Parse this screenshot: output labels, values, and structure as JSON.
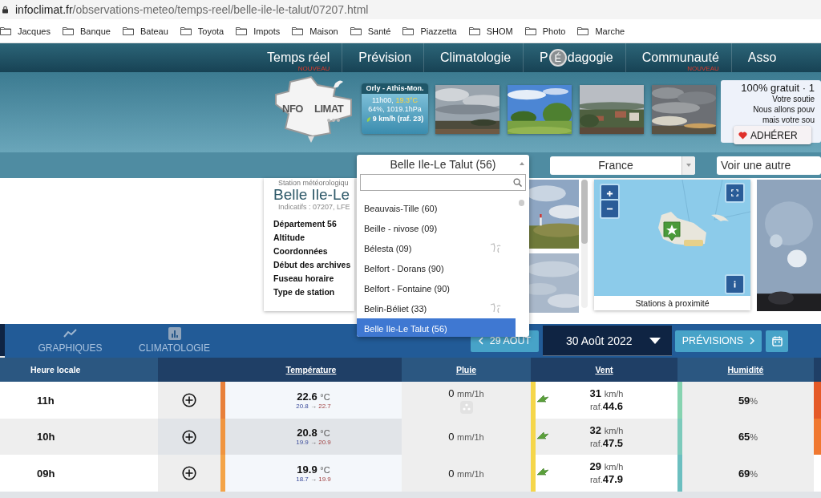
{
  "browser": {
    "url_host": "infoclimat.fr",
    "url_path": "/observations-meteo/temps-reel/belle-ile-le-talut/07207.html",
    "bookmarks": [
      "Jacques",
      "Banque",
      "Bateau",
      "Toyota",
      "Impots",
      "Maison",
      "Santé",
      "Piazzetta",
      "SHOM",
      "Photo",
      "Marche"
    ]
  },
  "nav": [
    {
      "label": "Temps réel",
      "tag": "NOUVEAU"
    },
    {
      "label": "Prévision"
    },
    {
      "label": "Climatologie"
    },
    {
      "label": "P",
      "emblem": "É",
      "label_end": "dagogie"
    },
    {
      "label": "Communauté",
      "tag": "NOUVEAU"
    },
    {
      "label": "Asso"
    }
  ],
  "logo": {
    "left": "NFO",
    "right": "LIMAT"
  },
  "live_station": {
    "name": "Orly - Athis-Mon.",
    "time": "11h00,",
    "temperature": "19.3°C",
    "humidity_pressure": "64%, 1019.1hPa",
    "wind": "9 km/h (raf. 23)"
  },
  "donation": {
    "title": "100% gratuit · 1",
    "lines": [
      "Votre soutie",
      "Nous allons pouv",
      "mais votre sou"
    ],
    "button": "ADHÉRER"
  },
  "station_select": {
    "value": "Belle Ile-Le Talut (56)",
    "expanded": true,
    "options": [
      {
        "label": "Beauvais-Tille (60)",
        "map_icon": false,
        "selected": false
      },
      {
        "label": "Beille - nivose (09)",
        "map_icon": false,
        "selected": false
      },
      {
        "label": "Bélesta (09)",
        "map_icon": true,
        "selected": false
      },
      {
        "label": "Belfort - Dorans (90)",
        "map_icon": false,
        "selected": false
      },
      {
        "label": "Belfort - Fontaine (90)",
        "map_icon": false,
        "selected": false
      },
      {
        "label": "Belin-Béliet (33)",
        "map_icon": true,
        "selected": false
      },
      {
        "label": "Belle Ile-Le Talut (56)",
        "map_icon": false,
        "selected": true
      }
    ]
  },
  "country_select": {
    "value": "France"
  },
  "station_search": {
    "placeholder": "Voir une autre"
  },
  "station": {
    "heading": "Station météorologiqu",
    "name": "Belle Ile-Le",
    "codes": "Indicatifs : 07207, LFE",
    "fields": [
      "Département 56",
      "Altitude",
      "Coordonnées",
      "Début des archives",
      "Fuseau horaire",
      "Type de station"
    ]
  },
  "map": {
    "caption": "Stations à proximité"
  },
  "tabs": [
    {
      "selected": true
    },
    {
      "label": "GRAPHIQUES",
      "selected": false
    },
    {
      "label": "CLIMATOLOGIE",
      "selected": false
    }
  ],
  "date_nav": {
    "previous": "29 AOUT",
    "date": "30 Août 2022",
    "next": "PRÉVISIONS"
  },
  "table": {
    "columns": [
      {
        "kind": "text",
        "label": "Heure locale"
      },
      {
        "kind": "blank"
      },
      {
        "kind": "link",
        "label": "Température"
      },
      {
        "kind": "link",
        "label": "Pluie"
      },
      {
        "kind": "link",
        "label": "Vent"
      },
      {
        "kind": "link",
        "label": "Humidité"
      }
    ],
    "rows": [
      {
        "hour": "11h",
        "temperature": {
          "value": "22.6",
          "unit": "°C",
          "min": "20.8",
          "arrow": "→",
          "max": "22.7",
          "color": "#e8803a"
        },
        "rain": {
          "value": "0",
          "unit": "mm/1h",
          "icon": true
        },
        "wind": {
          "value": "31",
          "unit": "km/h",
          "gust_prefix": "raf.",
          "gust": "44.6",
          "color": "#f5d64a"
        },
        "humidity": {
          "value": "59",
          "unit": "%",
          "color": "#86d3b0"
        },
        "next_column": {
          "color": "#e55a28"
        }
      },
      {
        "hour": "10h",
        "temperature": {
          "value": "20.8",
          "unit": "°C",
          "min": "19.9",
          "arrow": "→",
          "max": "20.9",
          "color": "#f0943e"
        },
        "rain": {
          "value": "0",
          "unit": "mm/1h",
          "icon": false
        },
        "wind": {
          "value": "32",
          "unit": "km/h",
          "gust_prefix": "raf.",
          "gust": "47.5",
          "color": "#f5d64a"
        },
        "humidity": {
          "value": "65",
          "unit": "%",
          "color": "#7ccabb"
        },
        "next_column": {
          "color": "#f07830"
        }
      },
      {
        "hour": "09h",
        "temperature": {
          "value": "19.9",
          "unit": "°C",
          "min": "18.7",
          "arrow": "→",
          "max": "19.9",
          "color": "#f4a448"
        },
        "rain": {
          "value": "0",
          "unit": "mm/1h",
          "icon": false
        },
        "wind": {
          "value": "29",
          "unit": "km/h",
          "gust_prefix": "raf.",
          "gust": "47.9",
          "color": "#f5d64a"
        },
        "humidity": {
          "value": "69",
          "unit": "%",
          "color": "#6cbfc0"
        }
      }
    ]
  }
}
